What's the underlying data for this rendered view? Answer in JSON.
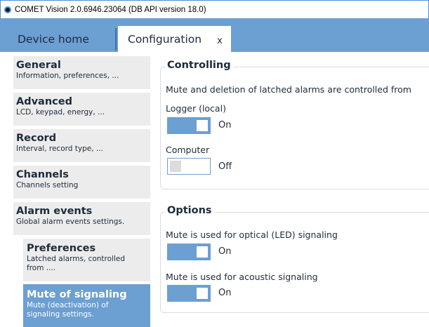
{
  "window": {
    "title": "COMET Vision 2.0.6946.23064 (DB API version 18.0)"
  },
  "tabs": [
    {
      "label": "Device home"
    },
    {
      "label": "Configuration",
      "close": "x"
    }
  ],
  "sidebar": {
    "items": [
      {
        "title": "General",
        "subtitle": "Information, preferences, ..."
      },
      {
        "title": "Advanced",
        "subtitle": "LCD, keypad, energy, ..."
      },
      {
        "title": "Record",
        "subtitle": "Interval, record type, ..."
      },
      {
        "title": "Channels",
        "subtitle": "Channels setting"
      },
      {
        "title": "Alarm events",
        "subtitle": "Global alarm events settings."
      }
    ],
    "children": [
      {
        "title": "Preferences",
        "subtitle": "Latched alarms, controlled from ...."
      },
      {
        "title": "Mute of signaling",
        "subtitle": "Mute (deactivation) of signaling settings.",
        "active": true
      }
    ]
  },
  "controlling": {
    "title": "Controlling",
    "description": "Mute and deletion of latched alarms are controlled from",
    "logger_label": "Logger (local)",
    "logger_state": "On",
    "computer_label": "Computer",
    "computer_state": "Off"
  },
  "options": {
    "title": "Options",
    "optical_label": "Mute is used for optical (LED) signaling",
    "optical_state": "On",
    "acoustic_label": "Mute is used for acoustic signaling",
    "acoustic_state": "On"
  },
  "colors": {
    "accent": "#6c9fd2",
    "nav_bg": "#ececec",
    "text": "#1d2b3a"
  }
}
